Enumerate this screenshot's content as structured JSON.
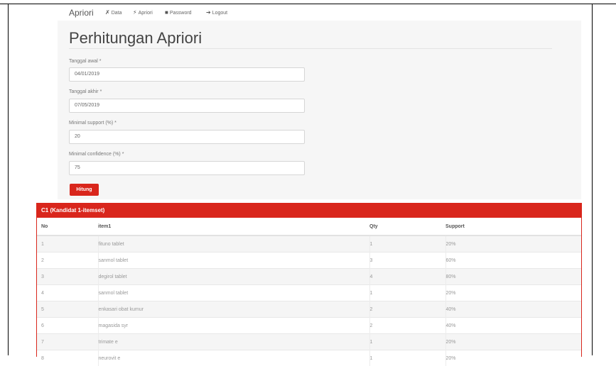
{
  "navbar": {
    "brand": "Apriori",
    "items": [
      {
        "icon": "wrench-icon",
        "glyph": "✗",
        "label": "Data"
      },
      {
        "icon": "bolt-icon",
        "glyph": "⚡",
        "label": "Apriori"
      },
      {
        "icon": "lock-icon",
        "glyph": "■",
        "label": "Password"
      },
      {
        "icon": "logout-icon",
        "glyph": "➔",
        "label": "Logout"
      }
    ]
  },
  "page": {
    "title": "Perhitungan Apriori"
  },
  "form": {
    "tanggal_awal": {
      "label": "Tanggal awal *",
      "value": "04/01/2019"
    },
    "tanggal_akhir": {
      "label": "Tanggal akhir *",
      "value": "07/05/2019"
    },
    "min_support": {
      "label": "Minimal support (%) *",
      "value": "20"
    },
    "min_confidence": {
      "label": "Minimal confidence (%) *",
      "value": "75"
    },
    "submit_label": "Hitung"
  },
  "c1": {
    "header": "C1 (Kandidat 1-itemset)",
    "columns": [
      "No",
      "item1",
      "Qty",
      "Support"
    ],
    "rows": [
      [
        "1",
        "fituno tablet",
        "1",
        "20%"
      ],
      [
        "2",
        "sanmol tablet",
        "3",
        "60%"
      ],
      [
        "3",
        "degirol tablet",
        "4",
        "80%"
      ],
      [
        "4",
        "sanmol tablet",
        "1",
        "20%"
      ],
      [
        "5",
        "enkasari obat kumur",
        "2",
        "40%"
      ],
      [
        "6",
        "magasida syr",
        "2",
        "40%"
      ],
      [
        "7",
        "trimate e",
        "1",
        "20%"
      ],
      [
        "8",
        "neurovit e",
        "1",
        "20%"
      ]
    ]
  },
  "colors": {
    "accent": "#d9261c",
    "panel": "#f6f6f6"
  }
}
